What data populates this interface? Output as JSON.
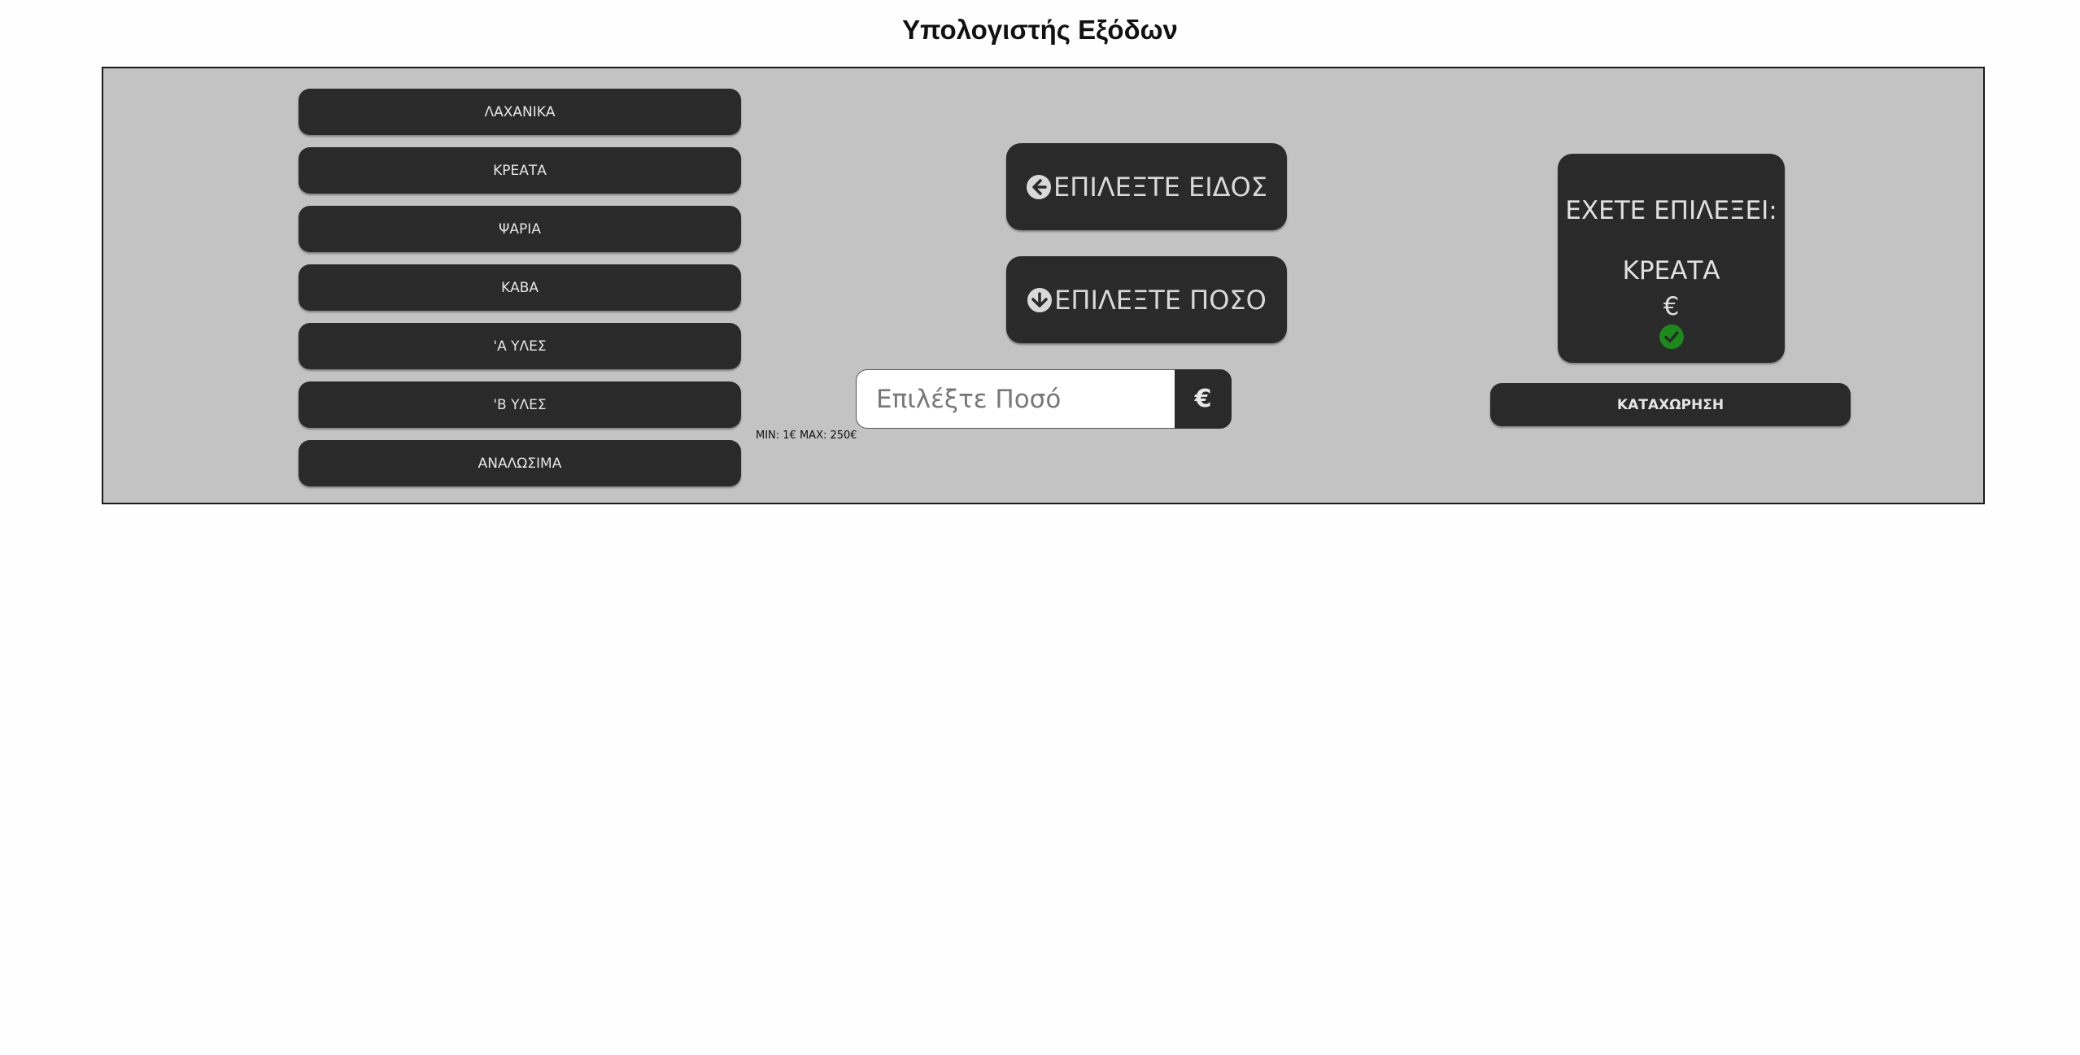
{
  "page": {
    "title": "Υπολογιστής Εξόδων"
  },
  "categories": [
    {
      "label": "ΛΑΧΑΝΙΚΑ"
    },
    {
      "label": "ΚΡΕΑΤΑ"
    },
    {
      "label": "ΨΑΡΙΑ"
    },
    {
      "label": "ΚΑΒΑ"
    },
    {
      "label": "'Α ΥΛΕΣ"
    },
    {
      "label": "'Β ΥΛΕΣ"
    },
    {
      "label": "ΑΝΑΛΩΣΙΜΑ"
    }
  ],
  "center": {
    "select_type_label": "ΕΠΙΛΕΞΤΕ ΕΙΔΟΣ",
    "select_type_icon": "arrow-left-circle-icon",
    "select_amount_label": "ΕΠΙΛΕΞΤΕ ΠΟΣΟ",
    "select_amount_icon": "arrow-down-circle-icon",
    "amount_input": {
      "value": "",
      "placeholder": "Επιλέξτε Ποσό"
    },
    "currency_symbol": "€",
    "limits_text": "MIN: 1€ MAX: 250€"
  },
  "summary": {
    "heading": "ΕΧΕΤΕ ΕΠΙΛΕΞΕΙ:",
    "selected_item": "ΚΡΕΑΤΑ",
    "selected_amount": "€",
    "status_icon": "check-circle-icon",
    "status_color": "#1a8a1a",
    "submit_label": "ΚΑΤΑΧΩΡΗΣΗ"
  },
  "colors": {
    "panel_bg": "#c3c3c3",
    "button_bg": "#2a2a2a",
    "button_text": "#e6e6e6"
  }
}
